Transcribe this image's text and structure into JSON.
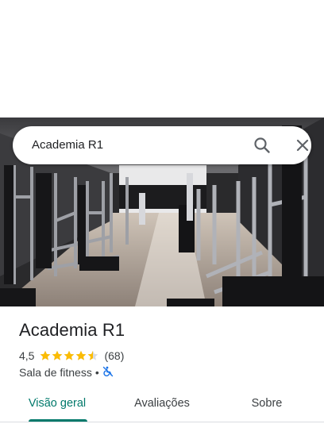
{
  "search": {
    "query": "Academia R1"
  },
  "place": {
    "name": "Academia R1",
    "rating_text": "4,5",
    "rating_value": 4.5,
    "rating_max": 5,
    "review_count": "(68)",
    "category": "Sala de fitness",
    "separator": "•",
    "accessibility_icon": "wheelchair-not-accessible-icon"
  },
  "tabs": [
    {
      "label": "Visão geral",
      "active": true
    },
    {
      "label": "Avaliações",
      "active": false
    },
    {
      "label": "Sobre",
      "active": false
    }
  ],
  "colors": {
    "accent": "#00796b",
    "star": "#fbbc04",
    "star_empty": "#dadce0",
    "accessibility_icon": "#1a73e8"
  }
}
